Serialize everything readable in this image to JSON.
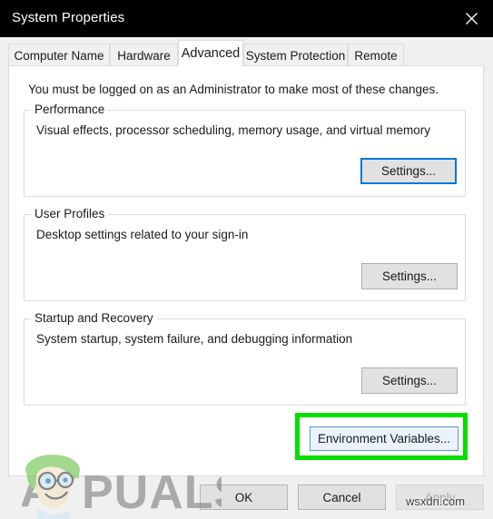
{
  "window": {
    "title": "System Properties",
    "close_icon": "close-icon"
  },
  "tabs": [
    {
      "label": "Computer Name",
      "active": false
    },
    {
      "label": "Hardware",
      "active": false
    },
    {
      "label": "Advanced",
      "active": true
    },
    {
      "label": "System Protection",
      "active": false
    },
    {
      "label": "Remote",
      "active": false
    }
  ],
  "content": {
    "admin_note": "You must be logged on as an Administrator to make most of these changes.",
    "groups": [
      {
        "legend": "Performance",
        "description": "Visual effects, processor scheduling, memory usage, and virtual memory",
        "button_label": "Settings...",
        "button_state": "focused"
      },
      {
        "legend": "User Profiles",
        "description": "Desktop settings related to your sign-in",
        "button_label": "Settings...",
        "button_state": "normal"
      },
      {
        "legend": "Startup and Recovery",
        "description": "System startup, system failure, and debugging information",
        "button_label": "Settings...",
        "button_state": "normal"
      }
    ],
    "environment_variables": {
      "label": "Environment Variables...",
      "state": "hovered",
      "highlight_color": "#00e000"
    }
  },
  "footer": {
    "ok_label": "OK",
    "cancel_label": "Cancel",
    "apply_label": "Apply",
    "apply_disabled": true
  },
  "watermarks": {
    "appuals": "PUALS",
    "wsxdn": "wsxdn.com"
  },
  "colors": {
    "titlebar_bg": "#000000",
    "panel_bg": "#ffffff",
    "window_bg": "#f0f0f0",
    "accent_focus": "#0078d7",
    "highlight_green": "#00e000",
    "button_face": "#e1e1e1"
  }
}
